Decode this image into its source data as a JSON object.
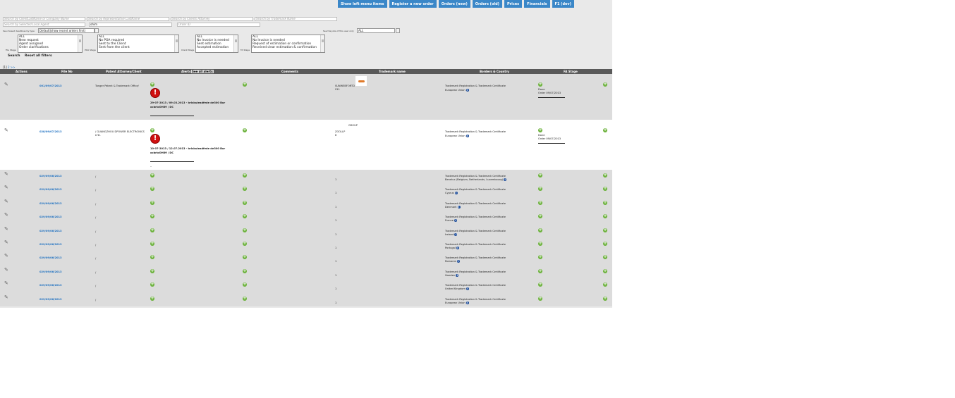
{
  "nav": [
    "Show left menu items",
    "Register a new order",
    "Orders (new)",
    "Orders (old)",
    "Prices",
    "Financials",
    "F1 (dev)"
  ],
  "search": {
    "client_placeholder": "Search by ClientLastName or Company Name",
    "rep_placeholder": "Search by Representative LastName",
    "attorney_placeholder": "Search by Clients Attorney",
    "trademark_placeholder": "Search by Trademark Name",
    "agent_placeholder": "Search by Selected Local Agent",
    "agent_value": "ohim",
    "order_placeholder": "Order ID"
  },
  "filters": {
    "deadline_label": "See missed deadlines by type",
    "deadline_value": "Default(show recent orders first)",
    "jobs_label": "See the jobs of this user only",
    "jobs_value": "ALL",
    "file_stage_label": "File Stage",
    "file_stage_options": [
      "ALL",
      "New request",
      "Agent assigned",
      "Order clarifications"
    ],
    "poa_stage_label": "POA Stage",
    "poa_stage_options": [
      "ALL",
      "No POA required",
      "Sent to the Client",
      "Sent from the client"
    ],
    "client_stage_label": "Client Stage",
    "client_stage_options": [
      "ALL",
      "No Invoice is needed",
      "Sent estimation",
      "Accepted estimation"
    ],
    "fa_stage_label": "FA Stage",
    "fa_stage_options": [
      "ALL",
      "No Invoice is needed",
      "Request of estimation or confirmation",
      "Received clear estimation & confirmation"
    ],
    "search_button": "Search",
    "reset_button": "Reset all filters"
  },
  "pager": {
    "current": "[1]",
    "next": "2",
    "more": ">>"
  },
  "table": {
    "headers": {
      "actions": "Actions",
      "file_no": "File No",
      "patent_attorney": "Patent Attorney/Client",
      "alerts": "Alerts",
      "see_all": "See all alerts",
      "comments": "Comments",
      "trademark": "Trademark name",
      "borders": "Borders & Country",
      "fa_stage": "FA Stage"
    },
    "rows": [
      {
        "file": "001/09/07/2013",
        "client": "Tanger Patent & Trademark Office/",
        "alert_text": "29-07-2013 / 09.03.2013 - brisbuleadfede de300 Bur",
        "alert_sub": "ocbrioOHIM / DC",
        "tm1": "SUNWEBFORTD",
        "tm2": "S11",
        "borders": "Trademark Registration & Trademark Certificate",
        "country": "European Union",
        "fa1": "Done",
        "fa2": "Order 09/07/2013"
      },
      {
        "file": "028/09/07/2013",
        "client": "/ GUANGZHOU DPOWER ELECTRONICS",
        "client2": "LTD.",
        "alert_text": "10-07-2013 / 12.07.2013 - brisbuleadfede de300 Bur",
        "alert_sub": "ocbrioOHIM / DC",
        "tm0": "GROUP",
        "tm1": "ZOOLLP",
        "tm2": "8",
        "borders": "Trademark Registration & Trademark Certificate",
        "country": "European Union",
        "fa1": "Done",
        "fa2": "Order 09/07/2013",
        "dash": "–"
      }
    ],
    "small_rows": [
      {
        "file": "029/09/06/2013",
        "client": "/",
        "tm": "1",
        "borders": "Trademark Registration & Trademark Certificate",
        "country": "Benelux (Belgium, Netherlands, Luxembourg)"
      },
      {
        "file": "029/09/06/2013",
        "client": "/",
        "tm": "1",
        "borders": "Trademark Registration & Trademark Certificate",
        "country": "Cyprus"
      },
      {
        "file": "029/09/06/2013",
        "client": "/",
        "tm": "1",
        "borders": "Trademark Registration & Trademark Certificate",
        "country": "Denmark"
      },
      {
        "file": "029/09/06/2013",
        "client": "/",
        "tm": "1",
        "borders": "Trademark Registration & Trademark Certificate",
        "country": "France"
      },
      {
        "file": "029/09/06/2013",
        "client": "/",
        "tm": "1",
        "borders": "Trademark Registration & Trademark Certificate",
        "country": "Ireland"
      },
      {
        "file": "029/09/06/2013",
        "client": "/",
        "tm": "1",
        "borders": "Trademark Registration & Trademark Certificate",
        "country": "Portugal"
      },
      {
        "file": "029/09/06/2013",
        "client": "/",
        "tm": "1",
        "borders": "Trademark Registration & Trademark Certificate",
        "country": "Romania"
      },
      {
        "file": "029/09/06/2013",
        "client": "/",
        "tm": "1",
        "borders": "Trademark Registration & Trademark Certificate",
        "country": "Sweden"
      },
      {
        "file": "029/09/06/2013",
        "client": "/",
        "tm": "1",
        "borders": "Trademark Registration & Trademark Certificate",
        "country": "United Kingdom"
      },
      {
        "file": "029/09/06/2013",
        "client": "/",
        "tm": "1",
        "borders": "Trademark Registration & Trademark Certificate",
        "country": "European Union"
      }
    ]
  }
}
